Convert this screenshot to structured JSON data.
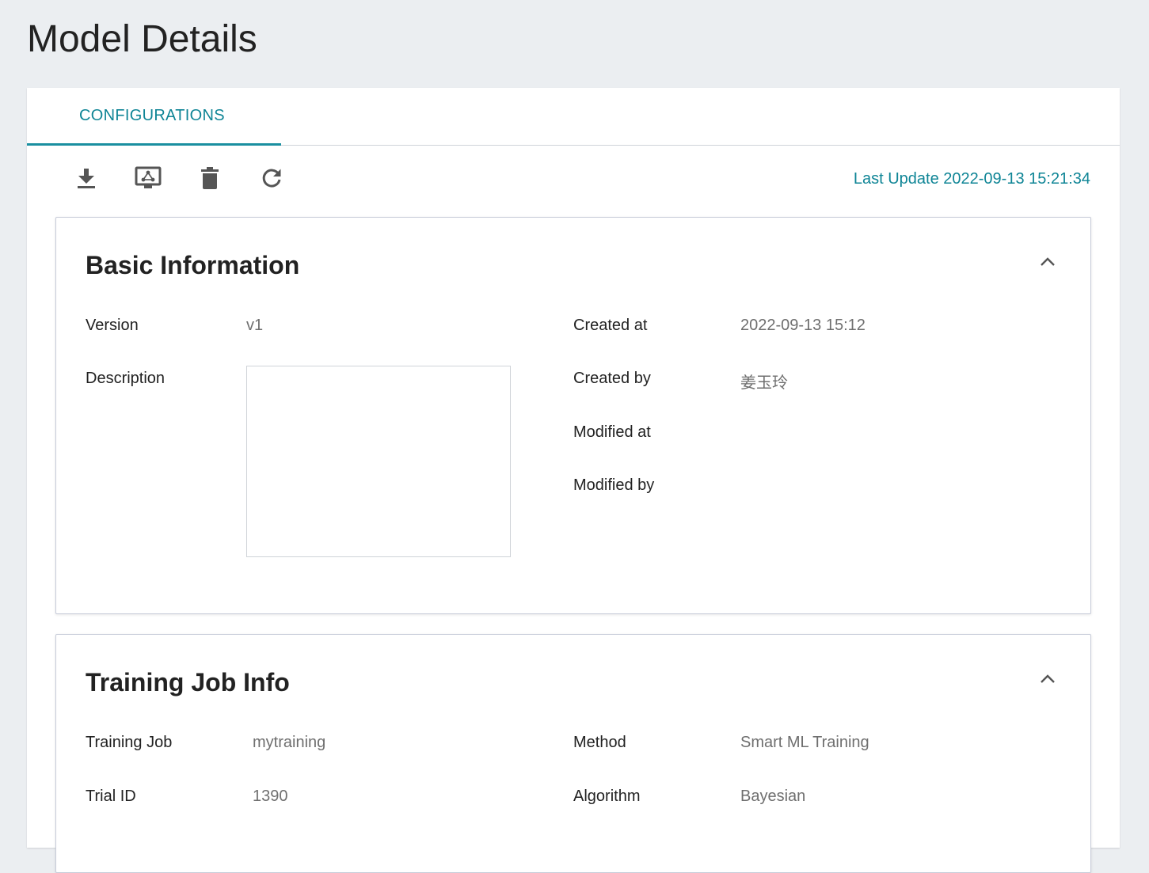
{
  "page": {
    "title": "Model Details"
  },
  "tabs": [
    {
      "label": "CONFIGURATIONS",
      "active": true
    }
  ],
  "toolbar": {
    "buttons": [
      {
        "icon": "download-icon"
      },
      {
        "icon": "deploy-icon"
      },
      {
        "icon": "delete-icon"
      },
      {
        "icon": "refresh-icon"
      }
    ],
    "last_update": "Last Update 2022-09-13 15:21:34"
  },
  "basic_info": {
    "title": "Basic Information",
    "version_label": "Version",
    "version_value": "v1",
    "description_label": "Description",
    "description_value": "",
    "created_at_label": "Created at",
    "created_at_value": "2022-09-13 15:12",
    "created_by_label": "Created by",
    "created_by_value": "姜玉玲",
    "modified_at_label": "Modified at",
    "modified_at_value": "",
    "modified_by_label": "Modified by",
    "modified_by_value": ""
  },
  "training_info": {
    "title": "Training Job Info",
    "job_label": "Training Job",
    "job_value": "mytraining",
    "trial_label": "Trial ID",
    "trial_value": "1390",
    "method_label": "Method",
    "method_value": "Smart ML Training",
    "algorithm_label": "Algorithm",
    "algorithm_value": "Bayesian"
  },
  "colors": {
    "accent": "#0f8596",
    "icon": "#555555",
    "background": "#ebeef1"
  }
}
